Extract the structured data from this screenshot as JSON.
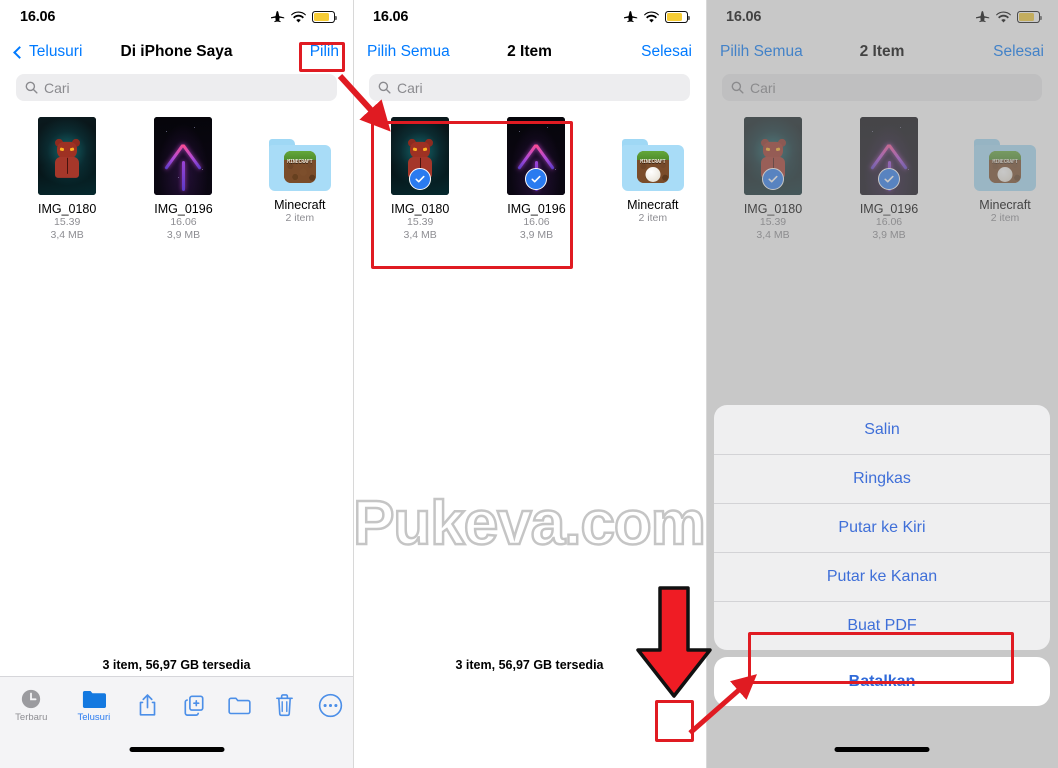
{
  "status_bar": {
    "time": "16.06",
    "icons": [
      "airplane-mode-icon",
      "wifi-icon",
      "battery-icon"
    ],
    "battery_color": "#f6cc35"
  },
  "colors": {
    "accent_blue": "#007aff",
    "sheet_blue": "#3f6fd8",
    "annotation_red": "#e01b22",
    "selection_blue": "#2a7bf0",
    "folder_blue": "#a8dcf7"
  },
  "watermark": {
    "text": "Pukeva.com"
  },
  "panel1": {
    "nav": {
      "back_label": "Telusuri",
      "title": "Di iPhone Saya",
      "action_label": "Pilih"
    },
    "search": {
      "placeholder": "Cari",
      "value": ""
    },
    "items": [
      {
        "name": "IMG_0180",
        "time": "15.39",
        "size": "3,4 MB",
        "kind": "photo",
        "selected": false
      },
      {
        "name": "IMG_0196",
        "time": "16.06",
        "size": "3,9 MB",
        "kind": "photo",
        "selected": false
      },
      {
        "name": "Minecraft",
        "time": "2 item",
        "size": "",
        "kind": "folder",
        "selected": false
      }
    ],
    "footer_status": "3 item, 56,97 GB tersedia"
  },
  "panel2": {
    "nav": {
      "back_label": "Pilih Semua",
      "title": "2 Item",
      "action_label": "Selesai"
    },
    "search": {
      "placeholder": "Cari",
      "value": ""
    },
    "items": [
      {
        "name": "IMG_0180",
        "time": "15.39",
        "size": "3,4 MB",
        "kind": "photo",
        "selected": true
      },
      {
        "name": "IMG_0196",
        "time": "16.06",
        "size": "3,9 MB",
        "kind": "photo",
        "selected": true
      },
      {
        "name": "Minecraft",
        "time": "2 item",
        "size": "",
        "kind": "folder",
        "selected": false
      }
    ],
    "footer_status": "3 item, 56,97 GB tersedia"
  },
  "panel3": {
    "nav": {
      "back_label": "Pilih Semua",
      "title": "2 Item",
      "action_label": "Selesai"
    },
    "search": {
      "placeholder": "Cari",
      "value": ""
    },
    "items": [
      {
        "name": "IMG_0180",
        "time": "15.39",
        "size": "3,4 MB",
        "kind": "photo",
        "selected": true
      },
      {
        "name": "IMG_0196",
        "time": "16.06",
        "size": "3,9 MB",
        "kind": "photo",
        "selected": true
      },
      {
        "name": "Minecraft",
        "time": "2 item",
        "size": "",
        "kind": "folder",
        "selected": false
      }
    ],
    "action_sheet": {
      "options": [
        "Salin",
        "Ringkas",
        "Putar ke Kiri",
        "Putar ke Kanan",
        "Buat PDF"
      ],
      "cancel_label": "Batalkan",
      "highlighted_option": "Buat PDF"
    }
  },
  "toolbar": {
    "tabs": [
      {
        "label": "Terbaru",
        "icon": "clock-icon",
        "active": false
      },
      {
        "label": "Telusuri",
        "icon": "folder-icon",
        "active": true
      }
    ],
    "actions": [
      {
        "icon": "share-icon",
        "name": "share-button"
      },
      {
        "icon": "duplicate-icon",
        "name": "duplicate-button"
      },
      {
        "icon": "new-folder-icon",
        "name": "new-folder-button"
      },
      {
        "icon": "trash-icon",
        "name": "delete-button"
      },
      {
        "icon": "ellipsis-circle-icon",
        "name": "more-button"
      }
    ]
  },
  "minecraft_icon": {
    "word": "MINECRAFT"
  }
}
